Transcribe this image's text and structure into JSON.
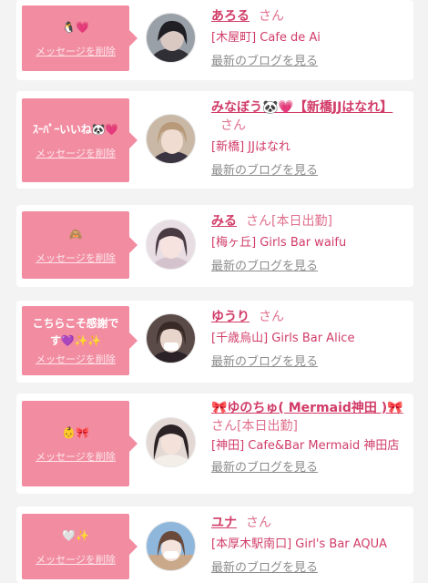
{
  "entries": [
    {
      "message": "🐧💗",
      "delete_label": "メッセージを削除",
      "name": "あろる",
      "honorific": "さん",
      "extra": "",
      "shop": "[木屋町] Cafe de Ai",
      "blog_link": "最新のブログを見る"
    },
    {
      "message": "ｽｰﾊﾟｰいいね🐼💗",
      "delete_label": "メッセージを削除",
      "name": "みなぼう🐼💗【新橋JJはなれ】",
      "honorific": "さん",
      "extra": "",
      "shop": "[新橋] JJはなれ",
      "blog_link": "最新のブログを見る"
    },
    {
      "message": "🙈",
      "delete_label": "メッセージを削除",
      "name": "みる",
      "honorific": "さん",
      "extra": "[本日出勤]",
      "shop": "[梅ヶ丘] Girls Bar waifu",
      "blog_link": "最新のブログを見る"
    },
    {
      "message": "こちらこそ感謝です💜✨✨",
      "delete_label": "メッセージを削除",
      "name": "ゆうり",
      "honorific": "さん",
      "extra": "",
      "shop": "[千歳烏山] Girls Bar Alice",
      "blog_link": "最新のブログを見る"
    },
    {
      "message": "👶🎀",
      "delete_label": "メッセージを削除",
      "name": "🎀ゆのちゅ( Mermaid神田 )🎀",
      "honorific": "さん",
      "extra": "[本日出勤]",
      "shop": "[神田] Cafe&Bar Mermaid 神田店",
      "blog_link": "最新のブログを見る"
    },
    {
      "message": "🤍✨",
      "delete_label": "メッセージを削除",
      "name": "ユナ",
      "honorific": "さん",
      "extra": "",
      "shop": "[本厚木駅南口] Girl's Bar AQUA",
      "blog_link": "最新のブログを見る"
    }
  ]
}
